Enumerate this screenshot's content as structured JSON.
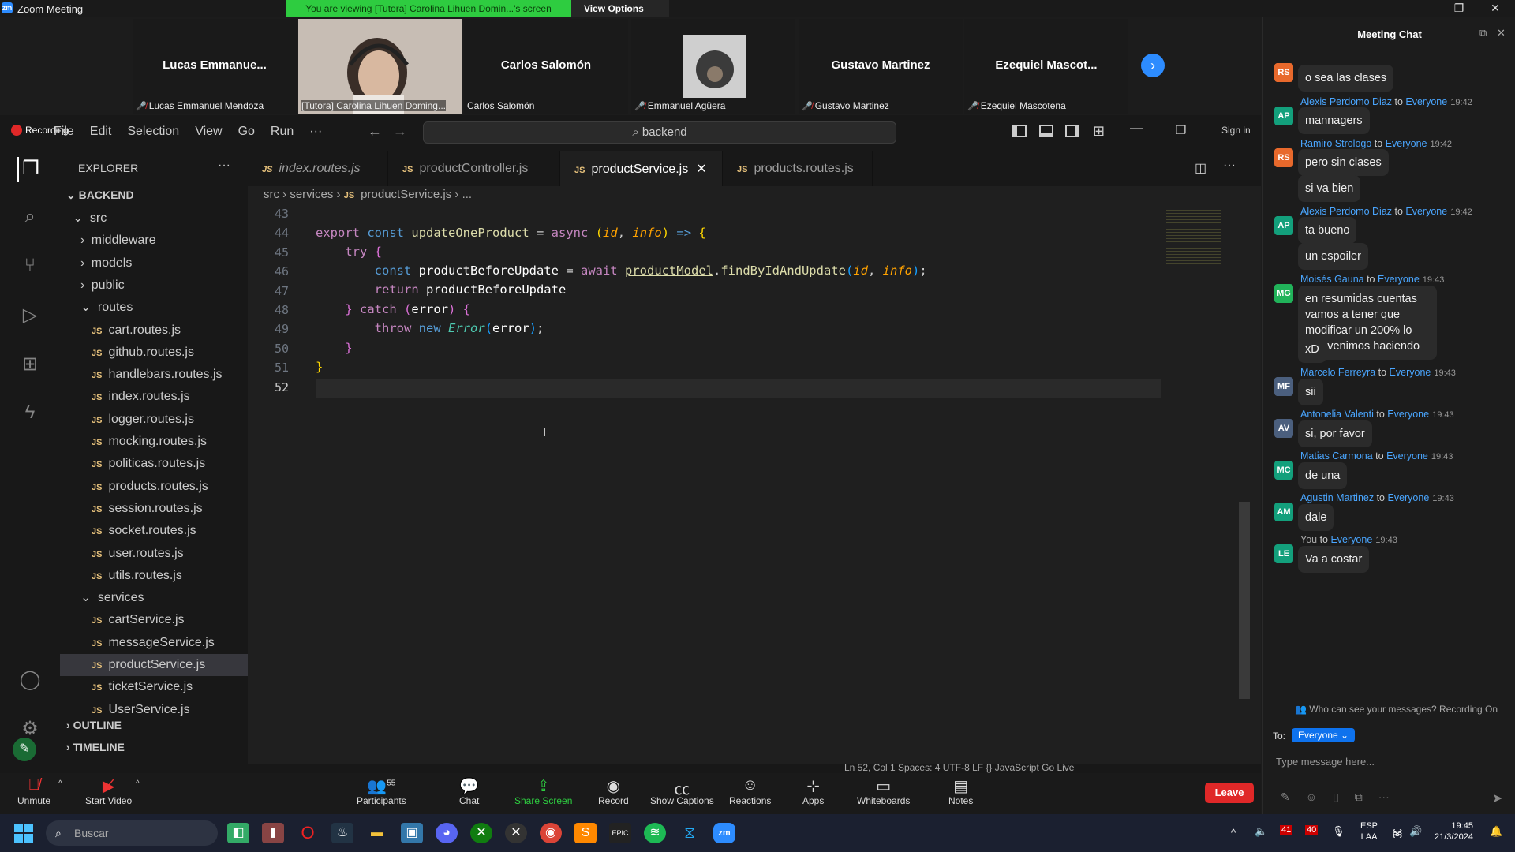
{
  "zoom": {
    "window_title": "Zoom Meeting",
    "viewing_banner": "You are viewing [Tutora] Carolina Lihuen Domin...'s screen",
    "view_options": "View Options",
    "participants": [
      {
        "display": "Lucas  Emmanue...",
        "label": "Lucas Emmanuel Mendoza"
      },
      {
        "display": "",
        "label": "[Tutora] Carolina Lihuen Doming..."
      },
      {
        "display": "Carlos Salomón",
        "label": "Carlos Salomón"
      },
      {
        "display": "",
        "label": "Emmanuel Agüera"
      },
      {
        "display": "Gustavo Martinez",
        "label": "Gustavo Martinez"
      },
      {
        "display": "Ezequiel  Mascot...",
        "label": "Ezequiel Mascotena"
      }
    ],
    "toolbar": {
      "unmute": "Unmute",
      "start_video": "Start Video",
      "participants": "Participants",
      "participant_count": "55",
      "chat": "Chat",
      "share_screen": "Share Screen",
      "record": "Record",
      "show_captions": "Show Captions",
      "reactions": "Reactions",
      "apps": "Apps",
      "whiteboards": "Whiteboards",
      "notes": "Notes",
      "leave": "Leave"
    },
    "recording_label": "Recording"
  },
  "vscode": {
    "menu": [
      "File",
      "Edit",
      "Selection",
      "View",
      "Go",
      "Run",
      "···"
    ],
    "search": "backend",
    "sign_in": "Sign in",
    "explorer_title": "EXPLORER",
    "root": "BACKEND",
    "tree": [
      {
        "name": "src",
        "type": "folder-open",
        "indent": 1
      },
      {
        "name": "middleware",
        "type": "folder",
        "indent": 2
      },
      {
        "name": "models",
        "type": "folder",
        "indent": 2
      },
      {
        "name": "public",
        "type": "folder",
        "indent": 2
      },
      {
        "name": "routes",
        "type": "folder-open",
        "indent": 2
      },
      {
        "name": "cart.routes.js",
        "type": "file",
        "indent": 3
      },
      {
        "name": "github.routes.js",
        "type": "file",
        "indent": 3
      },
      {
        "name": "handlebars.routes.js",
        "type": "file",
        "indent": 3
      },
      {
        "name": "index.routes.js",
        "type": "file",
        "indent": 3
      },
      {
        "name": "logger.routes.js",
        "type": "file",
        "indent": 3
      },
      {
        "name": "mocking.routes.js",
        "type": "file",
        "indent": 3
      },
      {
        "name": "politicas.routes.js",
        "type": "file",
        "indent": 3
      },
      {
        "name": "products.routes.js",
        "type": "file",
        "indent": 3
      },
      {
        "name": "session.routes.js",
        "type": "file",
        "indent": 3
      },
      {
        "name": "socket.routes.js",
        "type": "file",
        "indent": 3
      },
      {
        "name": "user.routes.js",
        "type": "file",
        "indent": 3
      },
      {
        "name": "utils.routes.js",
        "type": "file",
        "indent": 3
      },
      {
        "name": "services",
        "type": "folder-open",
        "indent": 2
      },
      {
        "name": "cartService.js",
        "type": "file",
        "indent": 3
      },
      {
        "name": "messageService.js",
        "type": "file",
        "indent": 3
      },
      {
        "name": "productService.js",
        "type": "file",
        "indent": 3,
        "selected": true
      },
      {
        "name": "ticketService.js",
        "type": "file",
        "indent": 3
      },
      {
        "name": "UserService.js",
        "type": "file",
        "indent": 3
      }
    ],
    "outline": "OUTLINE",
    "timeline": "TIMELINE",
    "tabs": [
      {
        "label": "index.routes.js",
        "italic": true
      },
      {
        "label": "productController.js"
      },
      {
        "label": "productService.js",
        "active": true
      },
      {
        "label": "products.routes.js"
      }
    ],
    "breadcrumb": [
      "src",
      "services",
      "productService.js",
      "..."
    ],
    "line_numbers": [
      "43",
      "44",
      "45",
      "46",
      "47",
      "48",
      "49",
      "50",
      "51",
      "52"
    ],
    "status": "Ln 52, Col 1   Spaces: 4   UTF-8   LF   {} JavaScript   Go Live"
  },
  "chat": {
    "title": "Meeting Chat",
    "messages": [
      {
        "initials": "RS",
        "color": "#e8692c",
        "sender": "",
        "to": "",
        "time": "",
        "text": "o sea las clases"
      },
      {
        "initials": "AP",
        "color": "#13a07c",
        "sender": "Alexis Perdomo Diaz",
        "to": "Everyone",
        "time": "19:42",
        "text": "mannagers"
      },
      {
        "initials": "RS",
        "color": "#e8692c",
        "sender": "Ramiro Strologo",
        "to": "Everyone",
        "time": "19:42",
        "text": "pero sin clases"
      },
      {
        "initials": "",
        "color": "",
        "sender": "",
        "to": "",
        "time": "",
        "text": "si va bien"
      },
      {
        "initials": "AP",
        "color": "#13a07c",
        "sender": "Alexis Perdomo Diaz",
        "to": "Everyone",
        "time": "19:42",
        "text": "ta bueno"
      },
      {
        "initials": "",
        "color": "",
        "sender": "",
        "to": "",
        "time": "",
        "text": "un espoiler"
      },
      {
        "initials": "MG",
        "color": "#21b35a",
        "sender": "Moisés Gauna",
        "to": "Everyone",
        "time": "19:43",
        "text": "en resumidas cuentas vamos a tener que modificar un 200% lo que venimos haciendo"
      },
      {
        "initials": "",
        "color": "",
        "sender": "",
        "to": "",
        "time": "",
        "text": "xD"
      },
      {
        "initials": "MF",
        "color": "#4b5f7e",
        "sender": "Marcelo Ferreyra",
        "to": "Everyone",
        "time": "19:43",
        "text": "sii"
      },
      {
        "initials": "AV",
        "color": "#4b5f7e",
        "sender": "Antonelia Valenti",
        "to": "Everyone",
        "time": "19:43",
        "text": "si, por favor"
      },
      {
        "initials": "MC",
        "color": "#13a07c",
        "sender": "Matias Carmona",
        "to": "Everyone",
        "time": "19:43",
        "text": "de una"
      },
      {
        "initials": "AM",
        "color": "#13a07c",
        "sender": "Agustin Martinez",
        "to": "Everyone",
        "time": "19:43",
        "text": "dale"
      },
      {
        "initials": "LE",
        "color": "#13a07c",
        "sender": "You",
        "to": "Everyone",
        "time": "19:43",
        "text": "Va a costar"
      }
    ],
    "privacy_note": "Who can see your messages? Recording On",
    "to_label": "To:",
    "to_value": "Everyone",
    "input_placeholder": "Type message here..."
  },
  "taskbar": {
    "search_placeholder": "Buscar",
    "lang": "ESP",
    "lang2": "LAA",
    "time": "19:45",
    "date": "21/3/2024",
    "badge1": "41",
    "badge2": "40"
  }
}
